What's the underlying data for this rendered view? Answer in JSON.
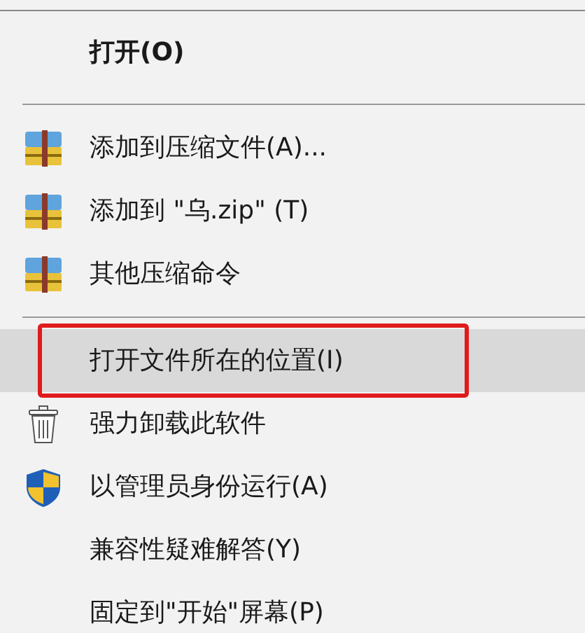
{
  "menu": {
    "items": [
      {
        "kind": "default",
        "label": "打开(O)",
        "selected": false,
        "outlined": false
      },
      {
        "kind": "separator"
      },
      {
        "kind": "archive",
        "label": "添加到压缩文件(A)...",
        "selected": false,
        "outlined": false
      },
      {
        "kind": "archive",
        "label": "添加到 \"乌.zip\" (T)",
        "selected": false,
        "outlined": false
      },
      {
        "kind": "archive",
        "label": "其他压缩命令",
        "selected": false,
        "outlined": false
      },
      {
        "kind": "separator"
      },
      {
        "kind": "plain",
        "label": "打开文件所在的位置(I)",
        "selected": true,
        "outlined": true
      },
      {
        "kind": "trash",
        "label": "强力卸载此软件",
        "selected": false,
        "outlined": false
      },
      {
        "kind": "shield",
        "label": "以管理员身份运行(A)",
        "selected": false,
        "outlined": false
      },
      {
        "kind": "plain",
        "label": "兼容性疑难解答(Y)",
        "selected": false,
        "outlined": false
      },
      {
        "kind": "plain",
        "label": "固定到\"开始\"屏幕(P)",
        "selected": false,
        "outlined": false
      }
    ]
  }
}
